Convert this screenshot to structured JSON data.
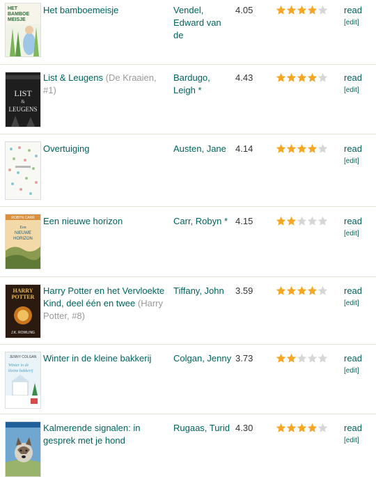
{
  "colors": {
    "link": "#00635d",
    "series": "#999999",
    "star_on": "#f5a623",
    "star_off": "#d6d6d6",
    "divider": "#e6e3d6"
  },
  "books": [
    {
      "title": "Het bamboemeisje",
      "series": "",
      "author": "Vendel, Edward van de",
      "author_mark": "",
      "avg_rating": "4.05",
      "my_rating": 4,
      "shelf": "read",
      "edit": "[edit]",
      "cover_text": "HET BAMBOE MEISJE",
      "cover_icon": "book-cover-green"
    },
    {
      "title": "List & Leugens",
      "series": "(De Kraaien, #1)",
      "author": "Bardugo, Leigh",
      "author_mark": "*",
      "avg_rating": "4.43",
      "my_rating": 4,
      "shelf": "read",
      "edit": "[edit]",
      "cover_text": "LIST & LEUGENS",
      "cover_icon": "book-cover-dark"
    },
    {
      "title": "Overtuiging",
      "series": "",
      "author": "Austen, Jane",
      "author_mark": "",
      "avg_rating": "4.14",
      "my_rating": 4,
      "shelf": "read",
      "edit": "[edit]",
      "cover_text": "",
      "cover_icon": "book-cover-floral"
    },
    {
      "title": "Een nieuwe horizon",
      "series": "",
      "author": "Carr, Robyn",
      "author_mark": "*",
      "avg_rating": "4.15",
      "my_rating": 2,
      "shelf": "read",
      "edit": "[edit]",
      "cover_text": "Een NIEUWE HORIZON",
      "cover_icon": "book-cover-landscape"
    },
    {
      "title": "Harry Potter en het Vervloekte Kind, deel één en twee",
      "series": "(Harry Potter, #8)",
      "author": "Tiffany, John",
      "author_mark": "",
      "avg_rating": "3.59",
      "my_rating": 4,
      "shelf": "read",
      "edit": "[edit]",
      "cover_text": "HARRY POTTER",
      "cover_icon": "book-cover-harry-potter"
    },
    {
      "title": "Winter in de kleine bakkerij",
      "series": "",
      "author": "Colgan, Jenny",
      "author_mark": "",
      "avg_rating": "3.73",
      "my_rating": 2,
      "shelf": "read",
      "edit": "[edit]",
      "cover_text": "Winter in de kleine bakkerij",
      "cover_icon": "book-cover-winter"
    },
    {
      "title": "Kalmerende signalen: in gesprek met je hond",
      "series": "",
      "author": "Rugaas, Turid",
      "author_mark": "",
      "avg_rating": "4.30",
      "my_rating": 4,
      "shelf": "read",
      "edit": "[edit]",
      "cover_text": "",
      "cover_icon": "book-cover-dog"
    }
  ]
}
